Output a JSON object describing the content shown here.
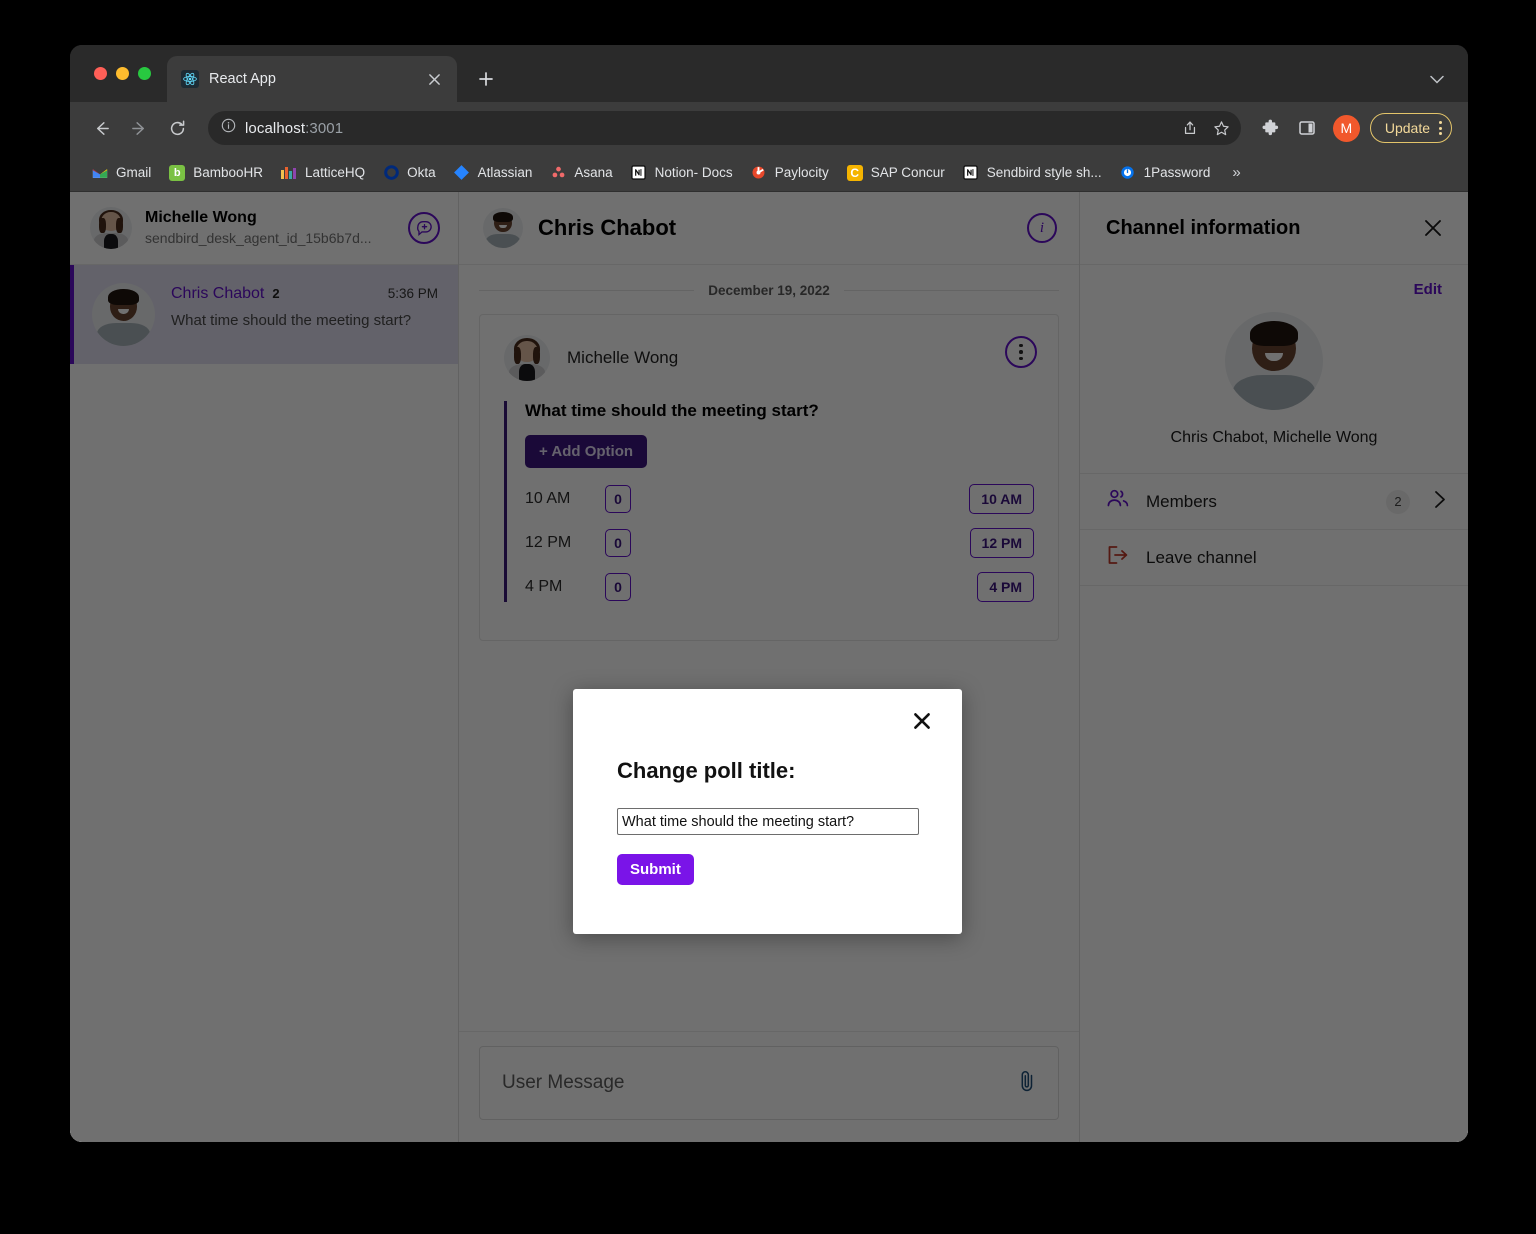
{
  "browser": {
    "tab": {
      "title": "React App",
      "favicon_icon": "react-logo-icon",
      "close_icon": "close-icon"
    },
    "new_tab_icon": "plus-icon",
    "tab_list_chevron_icon": "chevron-down-icon",
    "back_icon": "arrow-left-icon",
    "forward_icon": "arrow-right-icon",
    "reload_icon": "reload-icon",
    "site_info_icon": "info-circle-icon",
    "url": {
      "host": "localhost",
      "port": ":3001"
    },
    "share_icon": "share-icon",
    "bookmark_star_icon": "star-icon",
    "extensions_icon": "puzzle-piece-icon",
    "side_panel_icon": "side-panel-icon",
    "profile_initial": "M",
    "update_label": "Update",
    "update_menu_icon": "kebab-menu-icon",
    "bookmarks": [
      {
        "label": "Gmail",
        "icon": "gmail-icon"
      },
      {
        "label": "BambooHR",
        "icon": "bamboohr-icon"
      },
      {
        "label": "LatticeHQ",
        "icon": "lattice-icon"
      },
      {
        "label": "Okta",
        "icon": "okta-icon"
      },
      {
        "label": "Atlassian",
        "icon": "atlassian-icon"
      },
      {
        "label": "Asana",
        "icon": "asana-icon"
      },
      {
        "label": "Notion- Docs",
        "icon": "notion-icon"
      },
      {
        "label": "Paylocity",
        "icon": "paylocity-icon"
      },
      {
        "label": "SAP Concur",
        "icon": "sap-concur-icon"
      },
      {
        "label": "Sendbird style sh...",
        "icon": "notion-icon"
      },
      {
        "label": "1Password",
        "icon": "onepassword-icon"
      }
    ],
    "bookmarks_overflow": "»"
  },
  "channel_list": {
    "current_user": {
      "name": "Michelle Wong",
      "user_id": "sendbird_desk_agent_id_15b6b7d...",
      "avatar_name": "michelle-wong-avatar"
    },
    "create_channel_icon": "create-channel-icon",
    "items": [
      {
        "title": "Chris Chabot",
        "member_count": "2",
        "time": "5:36 PM",
        "preview": "What time should the meeting start?",
        "avatar_name": "chris-chabot-avatar"
      }
    ]
  },
  "conversation": {
    "header": {
      "title": "Chris Chabot",
      "avatar_name": "chris-chabot-avatar",
      "info_icon": "info-circle-icon"
    },
    "date_separator": "December 19, 2022",
    "message": {
      "author": "Michelle Wong",
      "avatar_name": "michelle-wong-avatar",
      "menu_icon": "more-vertical-icon",
      "poll": {
        "title": "What time should the meeting start?",
        "add_option_label": "+ Add Option",
        "options": [
          {
            "label": "10 AM",
            "count": "0",
            "vote_label": "10 AM"
          },
          {
            "label": "12 PM",
            "count": "0",
            "vote_label": "12 PM"
          },
          {
            "label": "4 PM",
            "count": "0",
            "vote_label": "4 PM"
          }
        ]
      }
    },
    "input": {
      "placeholder": "User Message",
      "attach_icon": "paperclip-icon"
    }
  },
  "info_panel": {
    "title": "Channel information",
    "close_icon": "close-icon",
    "edit_label": "Edit",
    "avatar_name": "chris-chabot-avatar",
    "member_names": "Chris Chabot, Michelle Wong",
    "rows": [
      {
        "label": "Members",
        "badge": "2",
        "icon": "members-icon",
        "chevron_icon": "chevron-right-icon"
      },
      {
        "label": "Leave channel",
        "badge": "",
        "icon": "leave-icon",
        "chevron_icon": ""
      }
    ]
  },
  "modal": {
    "close_icon": "close-icon",
    "title": "Change poll title:",
    "input_value": "What time should the meeting start?",
    "input_placeholder": "",
    "submit_label": "Submit"
  },
  "colors": {
    "primary": "#6210cc",
    "primary_dark": "#3d1580",
    "submit_purple": "#7a14e8",
    "selected_channel_bg": "#e2dff1",
    "leave_red": "#c0392b",
    "update_yellow": "#f3d99a"
  }
}
